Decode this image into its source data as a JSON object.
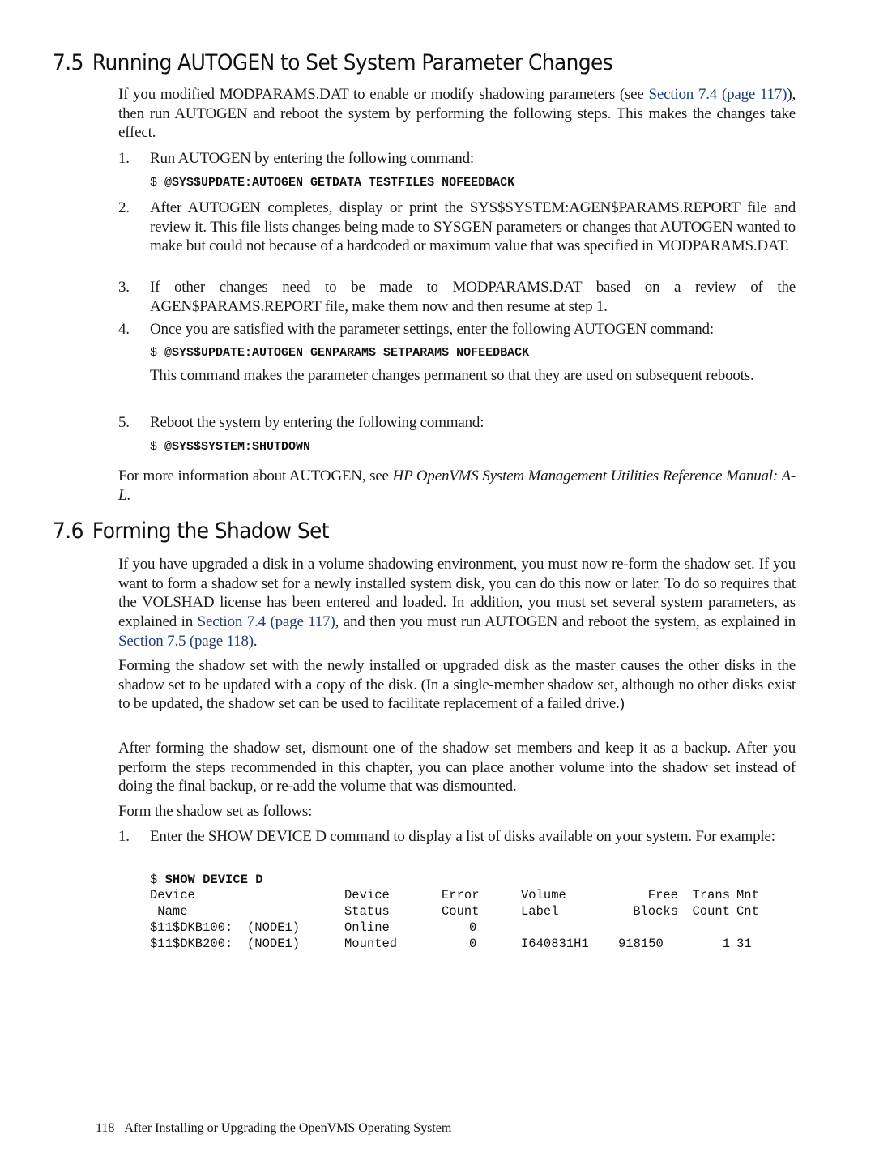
{
  "section_7_5": {
    "number": "7.5",
    "title": "Running AUTOGEN to Set System Parameter Changes",
    "intro": {
      "before_link": "If you modified MODPARAMS.DAT to enable or modify shadowing parameters (see ",
      "link": "Section 7.4 (page 117)",
      "after_link": "), then run AUTOGEN and reboot the system by performing the following steps. This makes the changes take effect."
    },
    "steps": [
      {
        "num": "1.",
        "text": "Run AUTOGEN by entering the following command:",
        "command_prompt": "$ ",
        "command": "@SYS$UPDATE:AUTOGEN GETDATA TESTFILES NOFEEDBACK"
      },
      {
        "num": "2.",
        "text": "After AUTOGEN completes, display or print the SYS$SYSTEM:AGEN$PARAMS.REPORT file and review it. This file lists changes being made to SYSGEN parameters or changes that AUTOGEN wanted to make but could not because of a hardcoded or maximum value that was specified in MODPARAMS.DAT."
      },
      {
        "num": "3.",
        "text": "If other changes need to be made to MODPARAMS.DAT based on a review of the AGEN$PARAMS.REPORT file, make them now and then resume at step 1."
      },
      {
        "num": "4.",
        "text": "Once you are satisfied with the parameter settings, enter the following AUTOGEN command:",
        "command_prompt": "$ ",
        "command": "@SYS$UPDATE:AUTOGEN GENPARAMS SETPARAMS NOFEEDBACK",
        "after": "This command makes the parameter changes permanent so that they are used on subsequent reboots."
      },
      {
        "num": "5.",
        "text": "Reboot the system by entering the following command:",
        "command_prompt": "$ ",
        "command": "@SYS$SYSTEM:SHUTDOWN"
      }
    ],
    "more_info": {
      "before": "For more information about AUTOGEN, see ",
      "italic": "HP OpenVMS System Management Utilities Reference Manual: A-L",
      "after": "."
    }
  },
  "section_7_6": {
    "number": "7.6",
    "title": "Forming the Shadow Set",
    "para1": {
      "part1": "If you have upgraded a disk in a volume shadowing environment, you must now re-form the shadow set. If you want to form a shadow set for a newly installed system disk, you can do this now or later. To do so requires that the VOLSHAD license has been entered and loaded. In addition, you must set several system parameters, as explained in ",
      "link1": "Section 7.4 (page 117)",
      "part2": ", and then you must run AUTOGEN and reboot the system, as explained in ",
      "link2": "Section 7.5 (page 118)",
      "part3": "."
    },
    "para2": "Forming the shadow set with the newly installed or upgraded disk as the master causes the other disks in the shadow set to be updated with a copy of the disk. (In a single-member shadow set, although no other disks exist to be updated, the shadow set can be used to facilitate replacement of a failed drive.)",
    "para3": "After forming the shadow set, dismount one of the shadow set members and keep it as a backup. After you perform the steps recommended in this chapter, you can place another volume into the shadow set instead of doing the final backup, or re-add the volume that was dismounted.",
    "para4": "Form the shadow set as follows:",
    "steps": [
      {
        "num": "1.",
        "text": "Enter the SHOW DEVICE D command to display a list of disks available on your system. For example:",
        "command_prompt": "$ ",
        "command": "SHOW DEVICE D"
      }
    ],
    "device_table": {
      "header_row1": [
        "Device",
        "",
        "Device",
        "Error",
        "Volume",
        "Free",
        "Trans",
        "Mnt"
      ],
      "header_row2": [
        " Name",
        "",
        "Status",
        "Count",
        "Label",
        "Blocks",
        "Count",
        "Cnt"
      ],
      "rows": [
        [
          "$11$DKB100:",
          "(NODE1)",
          "Online",
          "0",
          "",
          "",
          "",
          ""
        ],
        [
          "$11$DKB200:",
          "(NODE1)",
          "Mounted",
          "0",
          "I640831H1",
          "918150",
          "1",
          "31"
        ]
      ]
    }
  },
  "footer": {
    "page_number": "118",
    "running_title": "After Installing or Upgrading the OpenVMS Operating System"
  },
  "colors": {
    "link": "#1f3d7a",
    "text": "#1a1a1a"
  }
}
